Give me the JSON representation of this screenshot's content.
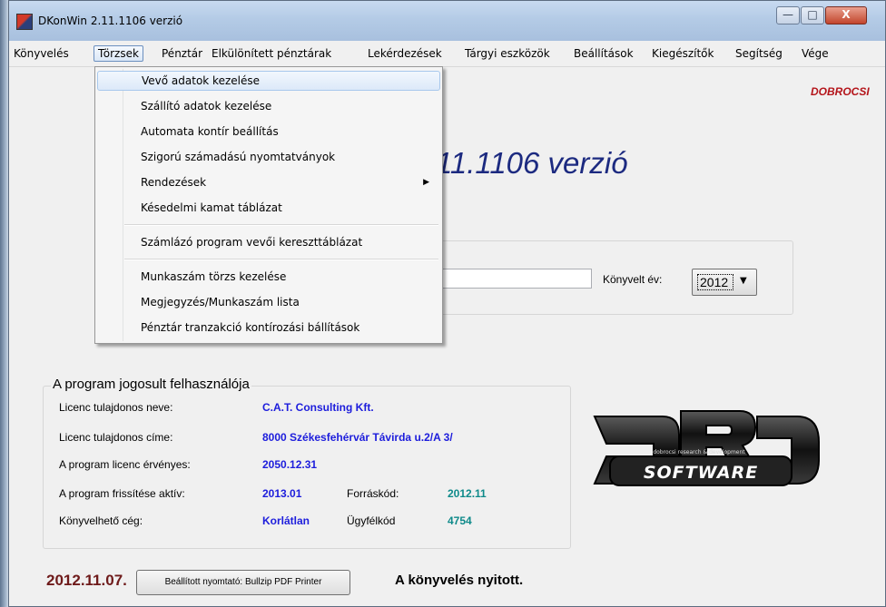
{
  "window": {
    "title": "DKonWin 2.11.1106 verzió"
  },
  "window_controls": {
    "minimize": "—",
    "maximize": "□",
    "close": "X"
  },
  "menubar": {
    "items": [
      {
        "label": "Könyvelés"
      },
      {
        "label": "Törzsek"
      },
      {
        "label": "Pénztár"
      },
      {
        "label": "Elkülönített pénztárak"
      },
      {
        "label": "Lekérdezések"
      },
      {
        "label": "Tárgyi eszközök"
      },
      {
        "label": "Beállítások"
      },
      {
        "label": "Kiegészítők"
      },
      {
        "label": "Segítség"
      },
      {
        "label": "Vége"
      }
    ]
  },
  "dropdown": {
    "items": [
      {
        "label": "Vevő adatok kezelése"
      },
      {
        "label": "Szállító adatok kezelése"
      },
      {
        "label": "Automata kontír beállítás"
      },
      {
        "label": "Szigorú számadású nyomtatványok"
      },
      {
        "label": "Rendezések",
        "submenu_arrow": "▶"
      },
      {
        "label": "Késedelmi kamat táblázat"
      },
      {
        "label": "Számlázó program vevői kereszttáblázat"
      },
      {
        "label": "Munkaszám törzs kezelése"
      },
      {
        "label": "Megjegyzés/Munkaszám lista"
      },
      {
        "label": "Pénztár tranzakció kontírozási bállítások"
      }
    ]
  },
  "main": {
    "company_tag": "DOBROCSI",
    "version_heading": "11.1106 verzió",
    "konyvelt_ev_label": "Könyvelt év:",
    "year_value": "2012",
    "year_arrow": "▼"
  },
  "license": {
    "group_title": "A program jogosult felhasználója",
    "rows": [
      {
        "label": "Licenc tulajdonos neve:",
        "value": "C.A.T. Consulting Kft."
      },
      {
        "label": "Licenc tulajdonos címe:",
        "value": "8000 Székesfehérvár Távirda u.2/A 3/"
      },
      {
        "label": "A program licenc érvényes:",
        "value": "2050.12.31"
      },
      {
        "label": "A program frissítése aktív:",
        "value": "2013.01",
        "extra_label": "Forráskód:",
        "extra_value": "2012.11"
      },
      {
        "label": "Könyvelhető cég:",
        "value": "Korlátlan",
        "extra_label": "Ügyfélkód",
        "extra_value": "4754"
      }
    ]
  },
  "logo": {
    "letters": "DRD",
    "tagline": "dobrocsi research & development",
    "software": "SOFTWARE"
  },
  "status": {
    "date": "2012.11.07.",
    "printer_button": "Beállított nyomtató: Bullzip PDF Printer",
    "state": "A könyvelés nyitott."
  },
  "colors": {
    "accent_blue": "#1d1ddc",
    "teal": "#0f8a8a",
    "company_red": "#b4141a",
    "date_maroon": "#6e1a1a",
    "version_navy": "#1c2a80"
  }
}
